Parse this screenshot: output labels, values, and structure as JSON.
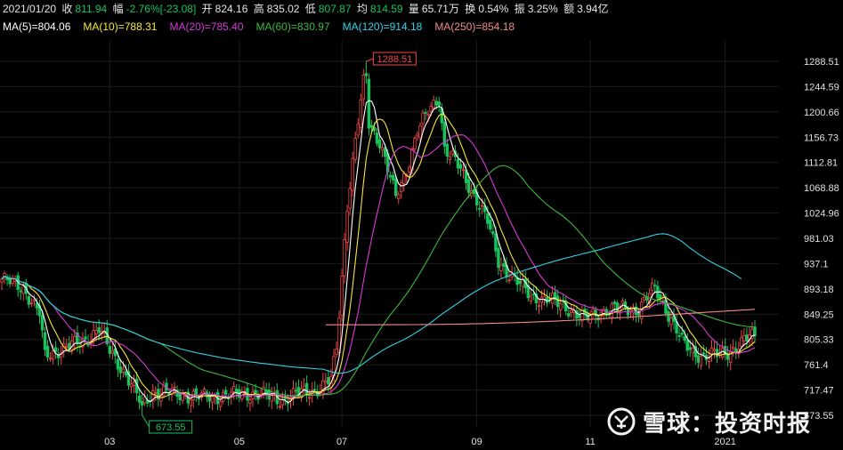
{
  "header": {
    "date": "2021/01/20",
    "close_label": "收",
    "close_value": "811.94",
    "change_label": "幅",
    "change_value": "-2.76%[-23.08]",
    "open_label": "开",
    "open_value": "824.16",
    "high_label": "高",
    "high_value": "835.02",
    "low_label": "低",
    "low_value": "807.87",
    "avg_label": "均",
    "avg_value": "814.59",
    "volume_label": "量",
    "volume_value": "65.71万",
    "turnover_label": "换",
    "turnover_value": "0.54%",
    "amplitude_label": "振",
    "amplitude_value": "3.25%",
    "amount_label": "额",
    "amount_value": "3.94亿"
  },
  "ma_legend": [
    {
      "text": "MA(5)=804.06",
      "color": "#ffffff"
    },
    {
      "text": "MA(10)=788.31",
      "color": "#f5e53b"
    },
    {
      "text": "MA(20)=785.40",
      "color": "#d63ad6"
    },
    {
      "text": "MA(60)=830.97",
      "color": "#3cb83c"
    },
    {
      "text": "MA(120)=914.18",
      "color": "#33d1e6"
    },
    {
      "text": "MA(250)=854.18",
      "color": "#f08a8a"
    }
  ],
  "watermark": {
    "text": "雪球：投资时报",
    "icon": "snowball-logo-icon"
  },
  "colors": {
    "up": "#f04848",
    "down": "#19c25c",
    "grid": "#1c1c1c",
    "axis_text": "#e0e0e0"
  },
  "chart_data": {
    "type": "candlestick",
    "title": "",
    "ylim": [
      673.55,
      1300
    ],
    "y_ticks": [
      "1288.51",
      "1244.59",
      "1200.66",
      "1156.73",
      "1112.81",
      "1068.88",
      "1024.96",
      "981.03",
      "937.1",
      "893.18",
      "849.25",
      "805.33",
      "761.4",
      "717.47",
      "673.55"
    ],
    "x_ticks": [
      "03",
      "05",
      "07",
      "09",
      "11",
      "2021"
    ],
    "x_tick_index": [
      40,
      88,
      126,
      176,
      218,
      268
    ],
    "annotations": [
      {
        "label": "1288.51",
        "type": "period-high",
        "index": 135,
        "value": 1288.51
      },
      {
        "label": "673.55",
        "type": "period-low",
        "index": 52,
        "value": 673.55
      }
    ],
    "key_points": [
      [
        0,
        910
      ],
      [
        8,
        895
      ],
      [
        14,
        850
      ],
      [
        16,
        775
      ],
      [
        22,
        790
      ],
      [
        30,
        800
      ],
      [
        36,
        825
      ],
      [
        40,
        785
      ],
      [
        46,
        745
      ],
      [
        52,
        690
      ],
      [
        56,
        715
      ],
      [
        66,
        710
      ],
      [
        74,
        705
      ],
      [
        84,
        708
      ],
      [
        92,
        712
      ],
      [
        100,
        705
      ],
      [
        104,
        700
      ],
      [
        110,
        712
      ],
      [
        118,
        720
      ],
      [
        122,
        735
      ],
      [
        124,
        790
      ],
      [
        128,
        1040
      ],
      [
        131,
        1150
      ],
      [
        134,
        1250
      ],
      [
        136,
        1180
      ],
      [
        140,
        1150
      ],
      [
        142,
        1120
      ],
      [
        146,
        1050
      ],
      [
        150,
        1100
      ],
      [
        154,
        1170
      ],
      [
        158,
        1200
      ],
      [
        162,
        1225
      ],
      [
        164,
        1140
      ],
      [
        168,
        1115
      ],
      [
        172,
        1080
      ],
      [
        176,
        1050
      ],
      [
        180,
        1010
      ],
      [
        184,
        940
      ],
      [
        190,
        910
      ],
      [
        196,
        880
      ],
      [
        202,
        875
      ],
      [
        210,
        860
      ],
      [
        216,
        840
      ],
      [
        222,
        855
      ],
      [
        230,
        860
      ],
      [
        236,
        858
      ],
      [
        242,
        895
      ],
      [
        246,
        860
      ],
      [
        252,
        800
      ],
      [
        256,
        785
      ],
      [
        260,
        775
      ],
      [
        266,
        780
      ],
      [
        272,
        790
      ],
      [
        276,
        805
      ],
      [
        277,
        812
      ]
    ],
    "series": [
      {
        "name": "MA(5)",
        "value": 804.06,
        "color": "#ffffff"
      },
      {
        "name": "MA(10)",
        "value": 788.31,
        "color": "#f5e53b"
      },
      {
        "name": "MA(20)",
        "value": 785.4,
        "color": "#d63ad6"
      },
      {
        "name": "MA(60)",
        "value": 830.97,
        "color": "#3cb83c"
      },
      {
        "name": "MA(120)",
        "value": 914.18,
        "color": "#33d1e6"
      },
      {
        "name": "MA(250)",
        "value": 854.18,
        "color": "#f08a8a"
      }
    ]
  }
}
